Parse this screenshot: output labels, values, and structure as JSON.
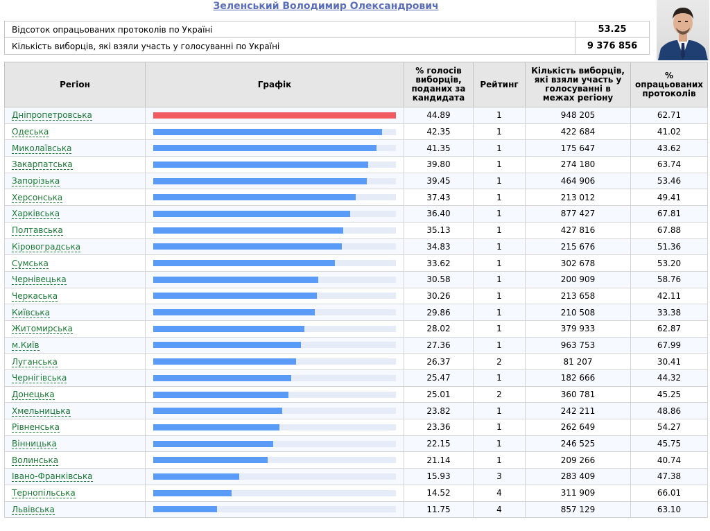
{
  "candidate": {
    "name": "Зеленський Володимир Олександрович"
  },
  "summary": {
    "rows": [
      {
        "label": "Відсоток опрацьованих протоколів по Україні",
        "value": "53.25"
      },
      {
        "label": "Кількість виборців, які взяли участь у голосуванні по Україні",
        "value": "9 376 856"
      }
    ]
  },
  "table": {
    "headers": {
      "region": "Регіон",
      "chart": "Графік",
      "percent": "% голосів виборців, поданих за кандидата",
      "rating": "Рейтинг",
      "voters": "Кількість виборців, які взяли участь у голосуванні в межах регіону",
      "protocols": "% опрацьованих протоколів"
    },
    "bar_max": 44.89,
    "colors": {
      "top_bar": "#f15b62",
      "bar": "#5b9bf8",
      "track": "#e6ecf7",
      "link": "#1a7a34",
      "title": "#5a6db8"
    },
    "rows": [
      {
        "region": "Дніпропетровська",
        "percent": "44.89",
        "rating": "1",
        "voters": "948 205",
        "protocols": "62.71"
      },
      {
        "region": "Одеська",
        "percent": "42.35",
        "rating": "1",
        "voters": "422 684",
        "protocols": "41.02"
      },
      {
        "region": "Миколаївська",
        "percent": "41.35",
        "rating": "1",
        "voters": "175 647",
        "protocols": "43.62"
      },
      {
        "region": "Закарпатська",
        "percent": "39.80",
        "rating": "1",
        "voters": "274 180",
        "protocols": "63.74"
      },
      {
        "region": "Запорізька",
        "percent": "39.45",
        "rating": "1",
        "voters": "464 906",
        "protocols": "53.46"
      },
      {
        "region": "Херсонська",
        "percent": "37.43",
        "rating": "1",
        "voters": "213 012",
        "protocols": "49.41"
      },
      {
        "region": "Харківська",
        "percent": "36.40",
        "rating": "1",
        "voters": "877 427",
        "protocols": "67.81"
      },
      {
        "region": "Полтавська",
        "percent": "35.13",
        "rating": "1",
        "voters": "427 816",
        "protocols": "67.88"
      },
      {
        "region": "Кіровоградська",
        "percent": "34.83",
        "rating": "1",
        "voters": "215 676",
        "protocols": "51.36"
      },
      {
        "region": "Сумська",
        "percent": "33.62",
        "rating": "1",
        "voters": "302 678",
        "protocols": "53.20"
      },
      {
        "region": "Чернівецька",
        "percent": "30.58",
        "rating": "1",
        "voters": "200 909",
        "protocols": "58.76"
      },
      {
        "region": "Черкаська",
        "percent": "30.26",
        "rating": "1",
        "voters": "213 658",
        "protocols": "42.11"
      },
      {
        "region": "Київська",
        "percent": "29.86",
        "rating": "1",
        "voters": "210 508",
        "protocols": "33.38"
      },
      {
        "region": "Житомирська",
        "percent": "28.02",
        "rating": "1",
        "voters": "379 933",
        "protocols": "62.87"
      },
      {
        "region": "м.Київ",
        "percent": "27.36",
        "rating": "1",
        "voters": "963 753",
        "protocols": "67.99"
      },
      {
        "region": "Луганська",
        "percent": "26.37",
        "rating": "2",
        "voters": "81 207",
        "protocols": "30.41"
      },
      {
        "region": "Чернігівська",
        "percent": "25.47",
        "rating": "1",
        "voters": "182 666",
        "protocols": "44.32"
      },
      {
        "region": "Донецька",
        "percent": "25.01",
        "rating": "2",
        "voters": "360 781",
        "protocols": "45.25"
      },
      {
        "region": "Хмельницька",
        "percent": "23.82",
        "rating": "1",
        "voters": "242 211",
        "protocols": "48.86"
      },
      {
        "region": "Рівненська",
        "percent": "23.36",
        "rating": "1",
        "voters": "262 649",
        "protocols": "54.27"
      },
      {
        "region": "Вінницька",
        "percent": "22.15",
        "rating": "1",
        "voters": "246 525",
        "protocols": "45.75"
      },
      {
        "region": "Волинська",
        "percent": "21.14",
        "rating": "1",
        "voters": "209 266",
        "protocols": "40.74"
      },
      {
        "region": "Івано-Франківська",
        "percent": "15.93",
        "rating": "3",
        "voters": "283 409",
        "protocols": "47.38"
      },
      {
        "region": "Тернопільська",
        "percent": "14.52",
        "rating": "4",
        "voters": "311 909",
        "protocols": "66.01"
      },
      {
        "region": "Львівська",
        "percent": "11.75",
        "rating": "4",
        "voters": "857 129",
        "protocols": "63.10"
      }
    ]
  }
}
